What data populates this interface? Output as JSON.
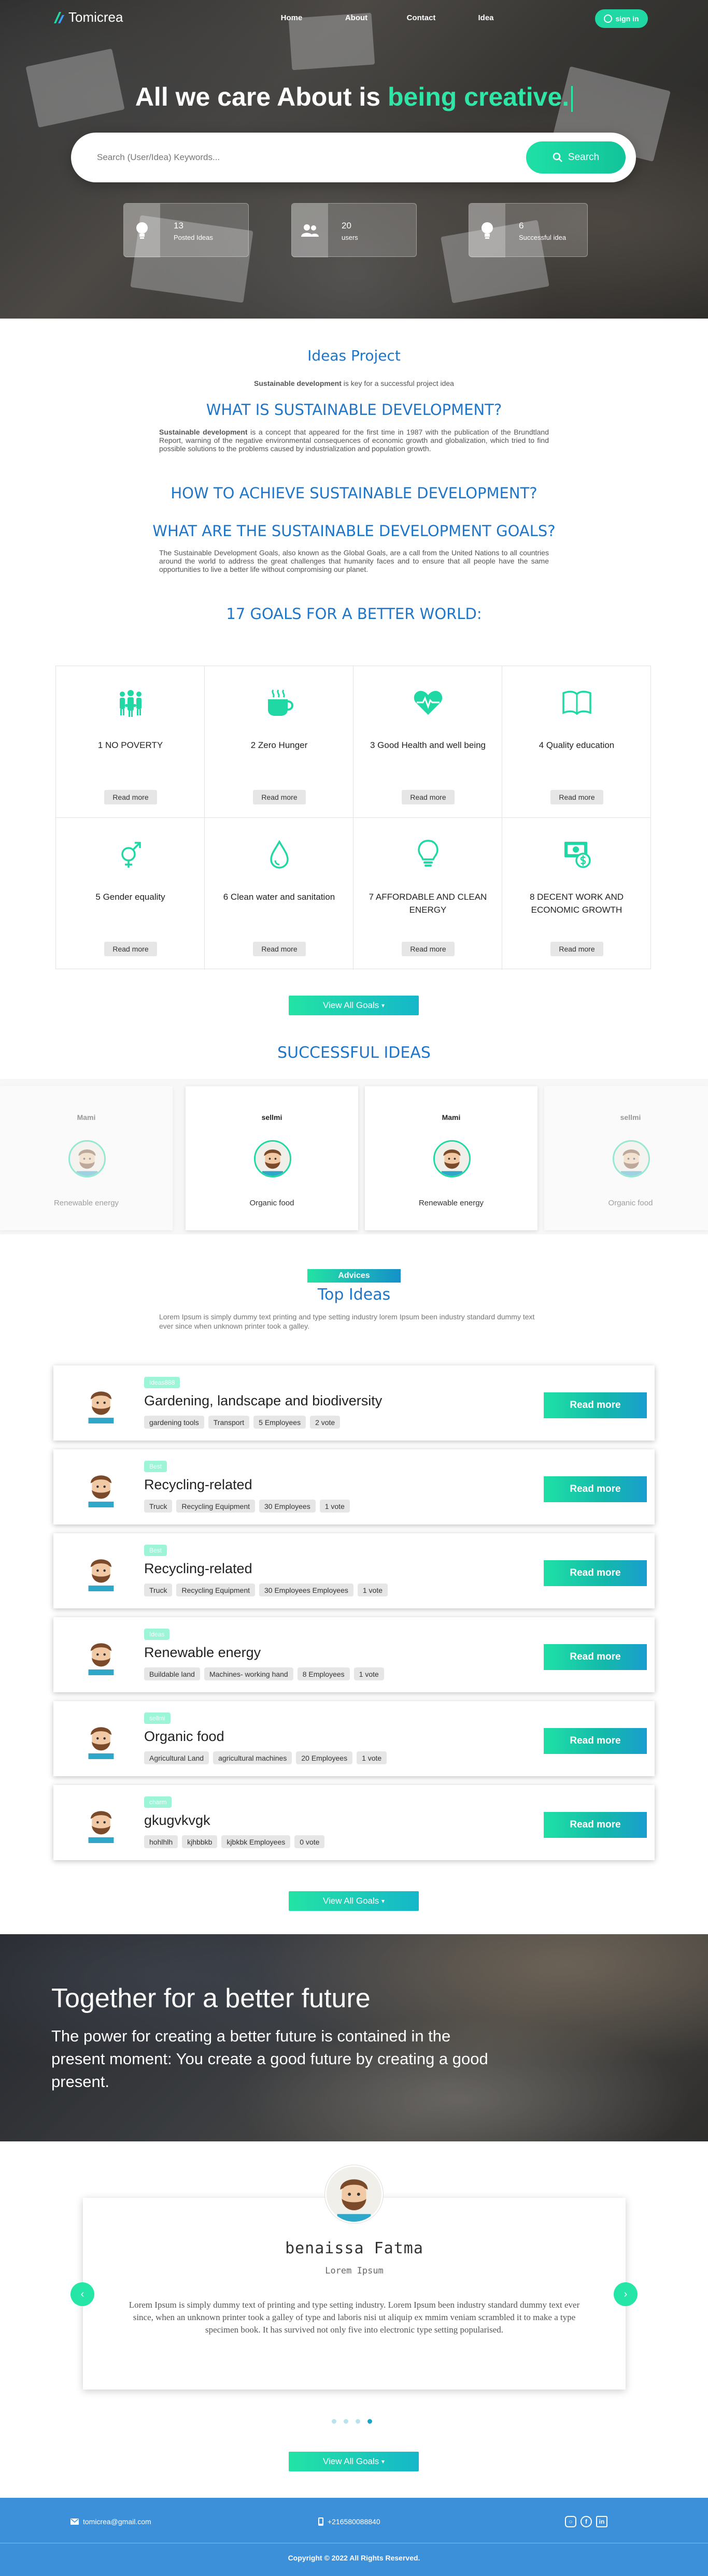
{
  "brand": {
    "name": "Tomicrea",
    "accent": "#1fd8a4",
    "blue": "#1f76c9"
  },
  "nav": {
    "links": [
      "Home",
      "About",
      "Contact",
      "Idea"
    ],
    "signin": "sign in"
  },
  "hero": {
    "title_plain": "All we care About is ",
    "title_accent": "being creative.",
    "search_placeholder": "Search (User/Idea) Keywords...",
    "search_button": "Search",
    "stats": [
      {
        "value": "13",
        "label": "Posted Ideas",
        "icon": "lightbulb-icon"
      },
      {
        "value": "20",
        "label": "users",
        "icon": "users-icon"
      },
      {
        "value": "6",
        "label": "Successful idea",
        "icon": "lightbulb-icon"
      }
    ]
  },
  "article": {
    "title": "Ideas Project",
    "subtitle_bold": "Sustainable development",
    "subtitle_rest": " is key for a successful project idea",
    "h1": "WHAT IS SUSTAINABLE DEVELOPMENT?",
    "p1_bold": "Sustainable development",
    "p1_rest": " is a concept that appeared for the first time in 1987 with the publication of the Brundtland Report, warning of the negative environmental consequences of economic growth and globalization, which tried to find possible solutions to the problems caused by industrialization and population growth.",
    "h2": "HOW TO ACHIEVE SUSTAINABLE DEVELOPMENT?",
    "h3": "WHAT ARE THE SUSTAINABLE DEVELOPMENT GOALS?",
    "p3": "The Sustainable Development Goals, also known as the Global Goals, are a call from the United Nations to all countries around the world to address the great challenges that humanity faces and to ensure that all people have the same opportunities to live a better life without compromising our planet.",
    "h4": "17 GOALS FOR A BETTER WORLD:"
  },
  "goals": {
    "items": [
      {
        "name": "1 NO POVERTY",
        "icon": "people-group-icon"
      },
      {
        "name": "2 Zero Hunger",
        "icon": "hot-cup-icon"
      },
      {
        "name": "3 Good Health and well being",
        "icon": "heartbeat-icon"
      },
      {
        "name": "4 Quality education",
        "icon": "open-book-icon"
      },
      {
        "name": "5 Gender equality",
        "icon": "gender-icon"
      },
      {
        "name": "6 Clean water and sanitation",
        "icon": "water-drop-icon"
      },
      {
        "name": "7 AFFORDABLE AND CLEAN ENERGY",
        "icon": "lightbulb-icon"
      },
      {
        "name": "8 DECENT WORK AND ECONOMIC GROWTH",
        "icon": "money-icon"
      }
    ],
    "read_more": "Read more",
    "view_all": "View All Goals"
  },
  "successful": {
    "title": "SUCCESSFUL IDEAS",
    "cards": [
      {
        "owner": "Mami",
        "category": "Renewable energy"
      },
      {
        "owner": "sellmi",
        "category": "Organic food"
      },
      {
        "owner": "Mami",
        "category": "Renewable energy"
      },
      {
        "owner": "sellmi",
        "category": "Organic food"
      }
    ]
  },
  "top_ideas": {
    "badge": "Advices",
    "title": "Top Ideas",
    "intro": "Lorem Ipsum is simply dummy text printing and type setting industry lorem Ipsum been industry standard dummy text ever since when unknown printer took a galley.",
    "read_more": "Read more",
    "items": [
      {
        "category": "Ideas888",
        "title": "Gardening, landscape and biodiversity",
        "tags": [
          "gardening tools",
          "Transport",
          "5 Employees",
          "2 vote"
        ]
      },
      {
        "category": "Best",
        "title": "Recycling-related",
        "tags": [
          "Truck",
          "Recycling Equipment",
          "30 Employees",
          "1 vote"
        ]
      },
      {
        "category": "Best",
        "title": "Recycling-related",
        "tags": [
          "Truck",
          "Recycling Equipment",
          "30 Employees Employees",
          "1 vote"
        ]
      },
      {
        "category": "Ideas",
        "title": "Renewable energy",
        "tags": [
          "Buildable land",
          "Machines- working hand",
          "8 Employees",
          "1 vote"
        ]
      },
      {
        "category": "sellmi",
        "title": "Organic food",
        "tags": [
          "Agricultural Land",
          "agricultural machines",
          "20 Employees",
          "1 vote"
        ]
      },
      {
        "category": "charm",
        "title": "gkugvkvgk",
        "tags": [
          "hohlhlh",
          "kjhbbkb",
          "kjbkbk Employees",
          "0 vote"
        ]
      }
    ],
    "view_all": "View All Goals"
  },
  "banner": {
    "title": "Together for a better future",
    "text": "The power for creating a better future is contained in the present moment: You create a good future by creating a good present."
  },
  "testimonial": {
    "name": "benaissa Fatma",
    "role": "Lorem Ipsum",
    "text": "Lorem Ipsum is simply dummy text of printing and type setting industry. Lorem Ipsum been industry standard dummy text ever since, when an unknown printer took a galley of type and laboris nisi ut aliquip ex mmim veniam scrambled it to make a type specimen book. It has survived not only five into electronic type setting popularised.",
    "dots_count": 4,
    "active_dot": 4,
    "view_all": "View All Goals"
  },
  "footer": {
    "email": "tomicrea@gmail.com",
    "phone": "+216580088840",
    "copyright": "Copyright © 2022 All Rights Reserved."
  }
}
